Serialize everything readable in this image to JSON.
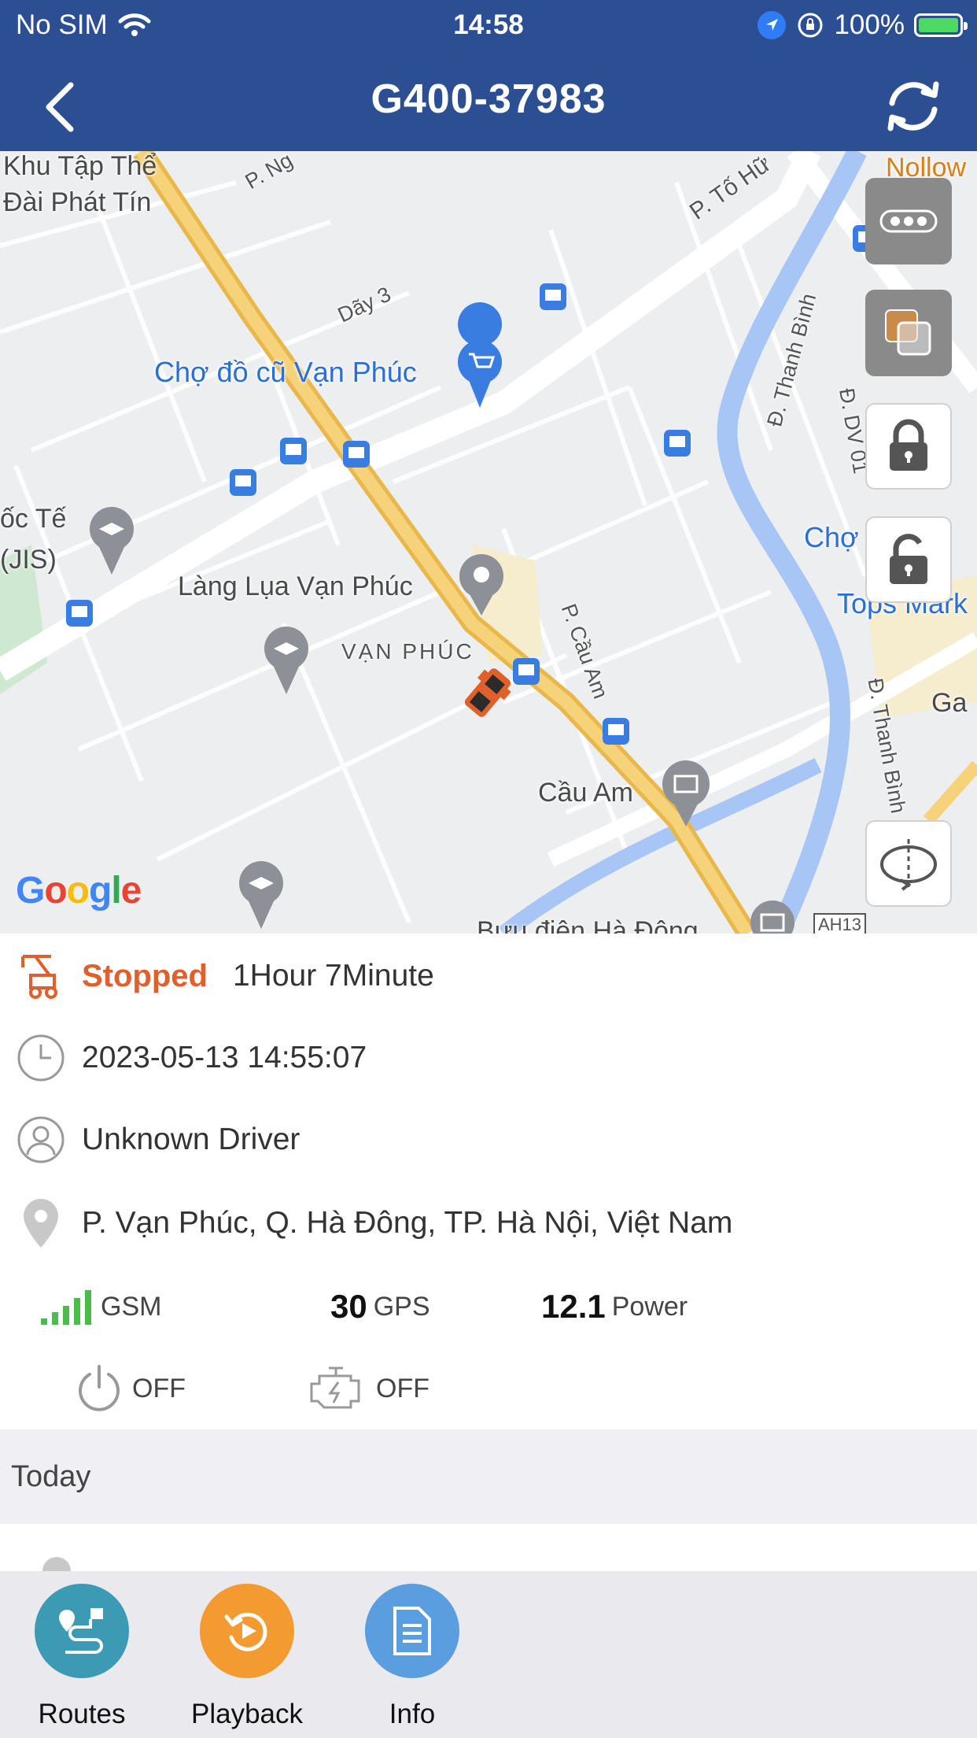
{
  "status_bar": {
    "carrier": "No SIM",
    "time": "14:58",
    "battery": "100%",
    "battery_level": 1.0
  },
  "nav": {
    "title": "G400-37983",
    "back_icon": "chevron-left-icon",
    "refresh_icon": "refresh-icon"
  },
  "map": {
    "labels": {
      "khu_tap_the_1": "Khu Tập Thể",
      "khu_tap_the_2": "Đài Phát Tín",
      "p_ng": "P. Ng",
      "p_to_hu": "P. Tố Hữ",
      "nollow": "Nollow",
      "day3": "Dãy 3",
      "cho_do_cu": "Chợ đồ cũ Vạn Phúc",
      "d_thanh_binh_top": "Đ. Thanh Bình",
      "d_dv01": "Đ. DV 01",
      "oc_te": "ốc Tế",
      "jis": "(JIS)",
      "cho_right": "Chợ",
      "tops_mark": "Tops Mark",
      "lang_lua": "Làng Lụa Vạn Phúc",
      "van_phuc": "VẠN PHÚC",
      "p_cau_am": "P. Cầu Am",
      "ga": "Ga",
      "d_thanh_binh_bottom": "Đ. Thanh Bình",
      "cau_am": "Cầu Am",
      "buu_dien": "Bưu điện Hà Đông",
      "ah13": "AH13",
      "google": "Google"
    },
    "buttons": {
      "more": "more-icon",
      "layers": "layers-icon",
      "lock": "lock-icon",
      "unlock": "unlock-icon",
      "rotate": "rotate-3d-icon"
    }
  },
  "vehicle": {
    "status": "Stopped",
    "duration": "1Hour 7Minute",
    "timestamp": "2023-05-13 14:55:07",
    "driver": "Unknown Driver",
    "address": "P. Vạn Phúc, Q. Hà Đông, TP. Hà Nội, Việt Nam",
    "gsm_label": "GSM",
    "gps_value": "30",
    "gps_label": "GPS",
    "power_value": "12.1",
    "power_label": "Power",
    "acc_state": "OFF",
    "engine_state": "OFF"
  },
  "today": {
    "label": "Today"
  },
  "tabs": [
    {
      "label": "Routes",
      "icon": "routes-icon",
      "color": "#3d9ab5"
    },
    {
      "label": "Playback",
      "icon": "playback-icon",
      "color": "#f39a30"
    },
    {
      "label": "Info",
      "icon": "document-icon",
      "color": "#5b9ee0"
    }
  ]
}
